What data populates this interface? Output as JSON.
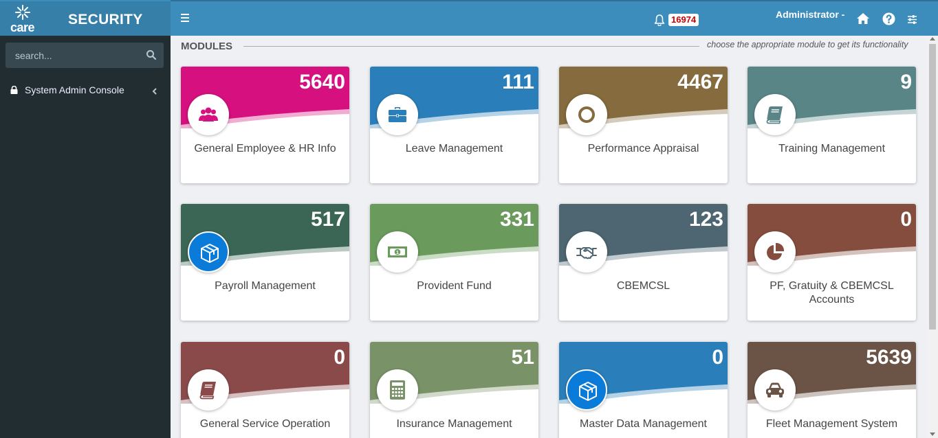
{
  "app": {
    "brand_title": "SECURITY",
    "logo_word": "care"
  },
  "search": {
    "placeholder": "search..."
  },
  "sidebar": {
    "items": [
      {
        "label": "System Admin Console"
      }
    ]
  },
  "topbar": {
    "notifications": "16974",
    "user": "Administrator -"
  },
  "modules": {
    "heading": "MODULES",
    "hint": "choose the appropriate module to get its functionality",
    "cards": [
      {
        "name": "General Employee & HR Info",
        "count": "5640",
        "color": "#d6107f",
        "icon": "users-icon"
      },
      {
        "name": "Leave Management",
        "count": "111",
        "color": "#2a7fba",
        "icon": "briefcase-icon"
      },
      {
        "name": "Performance Appraisal",
        "count": "4467",
        "color": "#856b3d",
        "icon": "circle-icon"
      },
      {
        "name": "Training Management",
        "count": "9",
        "color": "#5a8587",
        "icon": "book-icon"
      },
      {
        "name": "Payroll Management",
        "count": "517",
        "color": "#3b6655",
        "icon": "cube-icon"
      },
      {
        "name": "Provident Fund",
        "count": "331",
        "color": "#6a9a5c",
        "icon": "money-icon"
      },
      {
        "name": "CBEMCSL",
        "count": "123",
        "color": "#4d6672",
        "icon": "handshake-icon"
      },
      {
        "name": "PF, Gratuity & CBEMCSL Accounts",
        "count": "0",
        "color": "#854d3e",
        "icon": "pie-chart-icon"
      },
      {
        "name": "General Service Operation",
        "count": "0",
        "color": "#8a4a4a",
        "icon": "book-icon"
      },
      {
        "name": "Insurance Management",
        "count": "51",
        "color": "#7a9267",
        "icon": "calculator-icon"
      },
      {
        "name": "Master Data Management",
        "count": "0",
        "color": "#2a7fba",
        "icon": "cube-icon"
      },
      {
        "name": "Fleet Management System",
        "count": "5639",
        "color": "#6b5446",
        "icon": "car-icon"
      }
    ]
  }
}
